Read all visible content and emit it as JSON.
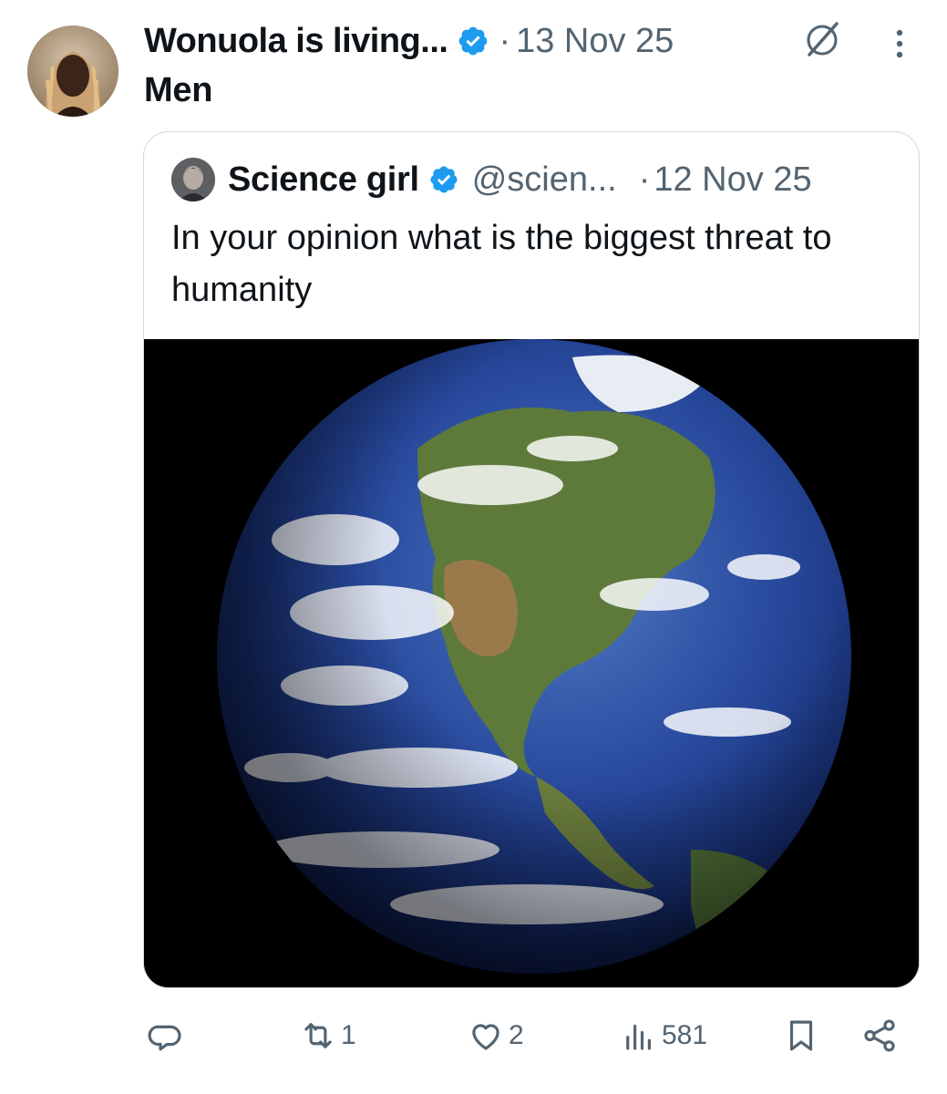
{
  "tweet": {
    "author_name": "Wonuola is living...",
    "separator": "·",
    "date": "13 Nov 25",
    "text": "Men",
    "avatar": "author-avatar-photo",
    "verified_icon": "verified-badge-icon"
  },
  "quote": {
    "author_name": "Science girl",
    "handle": "@scien...",
    "separator": "·",
    "date": "12 Nov 25",
    "text": "In your opinion what is the biggest threat to humanity",
    "media": "earth-from-space-photo"
  },
  "actions": {
    "reply": {
      "icon": "reply-icon",
      "count": ""
    },
    "repost": {
      "icon": "repost-icon",
      "count": "1"
    },
    "like": {
      "icon": "heart-icon",
      "count": "2"
    },
    "views": {
      "icon": "views-icon",
      "count": "581"
    },
    "bookmark": {
      "icon": "bookmark-icon"
    },
    "share": {
      "icon": "share-icon"
    }
  },
  "colors": {
    "text": "#0f1419",
    "muted": "#536471",
    "verified": "#1d9bf0",
    "border": "#cfd9de"
  }
}
